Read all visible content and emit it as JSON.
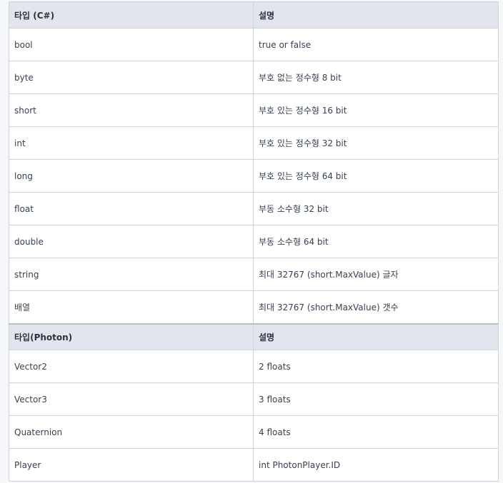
{
  "table1": {
    "headers": [
      "타입 (C#)",
      "설명"
    ],
    "rows": [
      [
        "bool",
        "true or false"
      ],
      [
        "byte",
        "부호 없는 정수형 8 bit"
      ],
      [
        "short",
        "부호 있는 정수형 16 bit"
      ],
      [
        "int",
        "부호 있는 정수형 32 bit"
      ],
      [
        "long",
        "부호 있는 정수형 64 bit"
      ],
      [
        "float",
        "부동 소수형 32 bit"
      ],
      [
        "double",
        "부동 소수형 64 bit"
      ],
      [
        "string",
        "최대 32767 (short.MaxValue) 글자"
      ],
      [
        "배열",
        "최대 32767 (short.MaxValue) 갯수"
      ]
    ]
  },
  "table2": {
    "headers": [
      "타입(Photon)",
      "설명"
    ],
    "rows": [
      [
        "Vector2",
        "2 floats"
      ],
      [
        "Vector3",
        "3 floats"
      ],
      [
        "Quaternion",
        "4 floats"
      ],
      [
        "Player",
        "int PhotonPlayer.ID"
      ]
    ]
  }
}
